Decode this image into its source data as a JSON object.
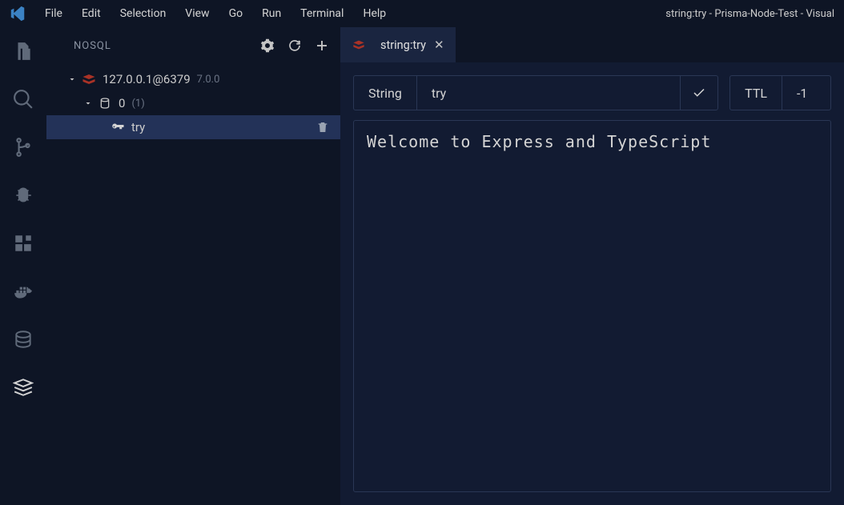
{
  "window": {
    "title": "string:try - Prisma-Node-Test - Visual"
  },
  "menu": {
    "items": [
      "File",
      "Edit",
      "Selection",
      "View",
      "Go",
      "Run",
      "Terminal",
      "Help"
    ]
  },
  "sidebar": {
    "title": "NOSQL",
    "connection": {
      "label": "127.0.0.1@6379",
      "version": "7.0.0"
    },
    "db": {
      "index": "0",
      "count": "(1)"
    },
    "key": {
      "name": "try"
    }
  },
  "tab": {
    "label": "string:try"
  },
  "editor": {
    "type_label": "String",
    "key_name": "try",
    "ttl_label": "TTL",
    "ttl_value": "-1",
    "value": "Welcome to Express and TypeScript"
  }
}
